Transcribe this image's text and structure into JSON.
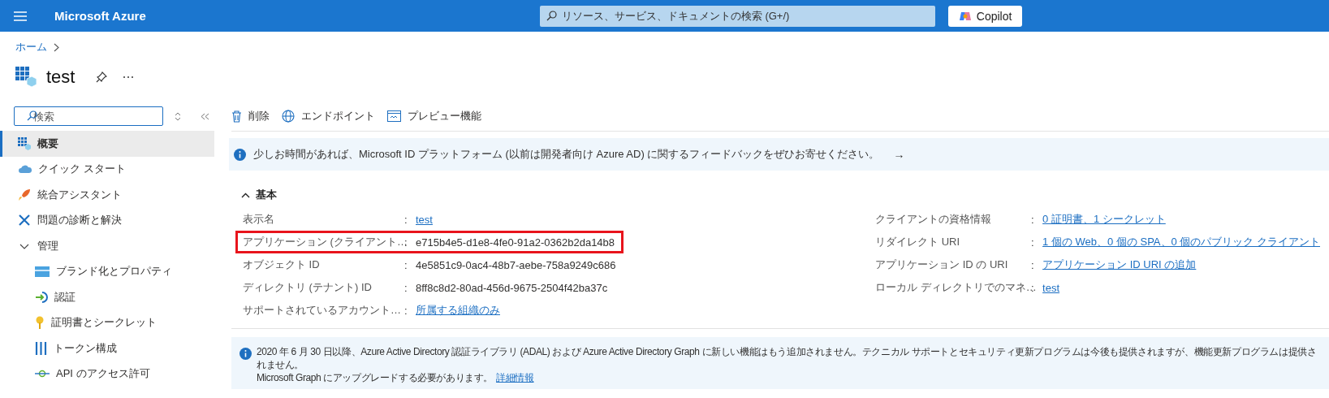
{
  "top_bar": {
    "brand": "Microsoft Azure",
    "search": {
      "placeholder": "リソース、サービス、ドキュメントの検索 (G+/)"
    },
    "copilot_button": "Copilot"
  },
  "breadcrumb": [
    {
      "label": "ホーム"
    }
  ],
  "page": {
    "title": "test"
  },
  "sidebar": {
    "search": {
      "placeholder": "検索"
    },
    "items": [
      {
        "label": "概要",
        "selected": true
      },
      {
        "label": "クイック スタート",
        "selected": false
      },
      {
        "label": "統合アシスタント",
        "selected": false
      },
      {
        "label": "問題の診断と解決",
        "selected": false
      },
      {
        "label": "管理",
        "selected": false,
        "expanded": true,
        "children": [
          {
            "label": "ブランド化とプロパティ",
            "selected": false
          },
          {
            "label": "認証",
            "selected": false
          },
          {
            "label": "証明書とシークレット",
            "selected": false
          },
          {
            "label": "トークン構成",
            "selected": false
          },
          {
            "label": "API のアクセス許可",
            "selected": false
          }
        ]
      }
    ]
  },
  "toolbar": [
    {
      "label": "削除"
    },
    {
      "label": "エンドポイント"
    },
    {
      "label": "プレビュー機能"
    }
  ],
  "feedback_banner": {
    "text": "少しお時間があれば、Microsoft ID プラットフォーム (以前は開発者向け Azure AD) に関するフィードバックをぜひお寄せください。",
    "arrow": "→"
  },
  "essentials": {
    "title": "基本",
    "expanded": true,
    "left": [
      {
        "label": "表示名",
        "separator": ":",
        "value": "test",
        "link": true,
        "highlighted": false
      },
      {
        "label": "アプリケーション (クライアント…",
        "separator": ":",
        "value": "e715b4e5-d1e8-4fe0-91a2-0362b2da14b8",
        "link": false,
        "highlighted": true
      },
      {
        "label": "オブジェクト ID",
        "separator": ":",
        "value": "4e5851c9-0ac4-48b7-aebe-758a9249c686",
        "link": false,
        "highlighted": false
      },
      {
        "label": "ディレクトリ (テナント) ID",
        "separator": ":",
        "value": "8ff8c8d2-80ad-456d-9675-2504f42ba37c",
        "link": false,
        "highlighted": false
      },
      {
        "label": "サポートされているアカウント…",
        "separator": ":",
        "value": "所属する組織のみ",
        "link": true,
        "highlighted": false
      }
    ],
    "right": [
      {
        "label": "クライアントの資格情報",
        "separator": ":",
        "value": "0 証明書、1 シークレット",
        "link": true,
        "highlighted": false
      },
      {
        "label": "リダイレクト URI",
        "separator": ":",
        "value": "1 個の Web、0 個の SPA、0 個のパブリック クライアント",
        "link": true,
        "highlighted": false
      },
      {
        "label": "アプリケーション ID の URI",
        "separator": ":",
        "value": "アプリケーション ID URI の追加",
        "link": true,
        "highlighted": false
      },
      {
        "label": "ローカル ディレクトリでのマネ…",
        "separator": ":",
        "value": "test",
        "link": true,
        "highlighted": false
      }
    ]
  },
  "notice": {
    "text": "2020 年 6 月 30 日以降、Azure Active Directory 認証ライブラリ (ADAL) および Azure Active Directory Graph に新しい機能はもう追加されません。テクニカル サポートとセキュリティ更新プログラムは今後も提供されますが、機能更新プログラムは提供されません。",
    "text_2": "Microsoft Graph にアップグレードする必要があります。",
    "link": "詳細情報"
  }
}
